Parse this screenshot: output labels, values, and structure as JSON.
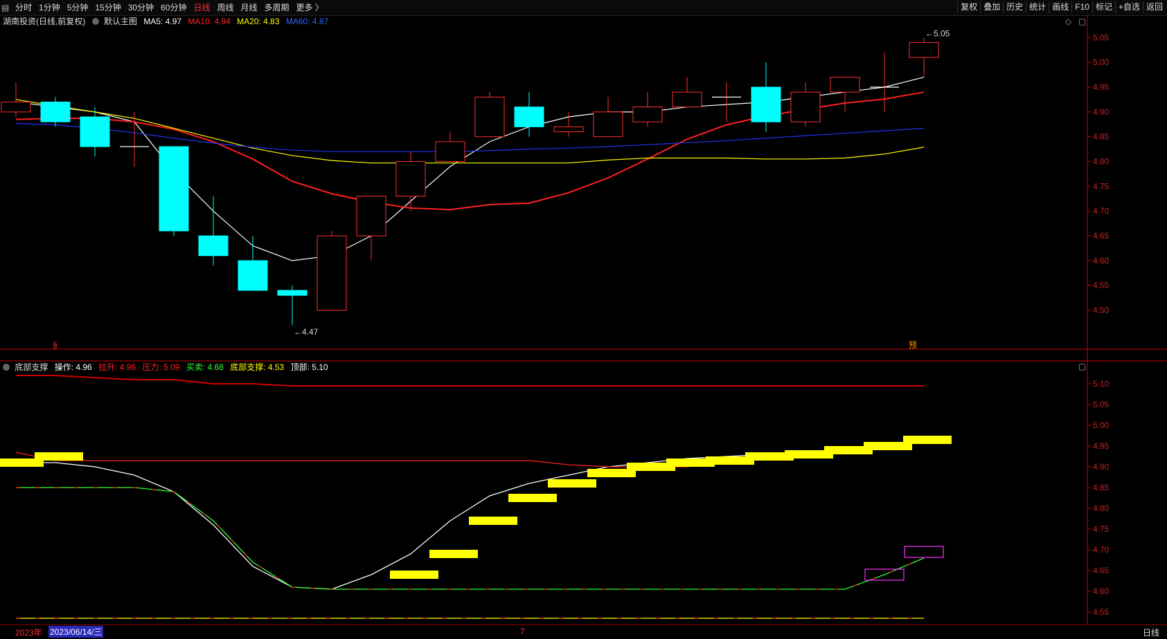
{
  "toolbar": {
    "left_items": [
      "分时",
      "1分钟",
      "5分钟",
      "15分钟",
      "30分钟",
      "60分钟",
      "日线",
      "周线",
      "月线",
      "多周期",
      "更多 〉"
    ],
    "active": "日线",
    "right_items": [
      "复权",
      "叠加",
      "历史",
      "统计",
      "画线",
      "F10",
      "标记",
      "+自选",
      "返回"
    ]
  },
  "main_legend": {
    "stock": "湖南投资(日线,前复权)",
    "template": "默认主图",
    "ma": [
      {
        "label": "MA5: 4.97",
        "color": "#ffffff"
      },
      {
        "label": "MA10: 4.94",
        "color": "#ff2020"
      },
      {
        "label": "MA20: 4.83",
        "color": "#ffff00"
      },
      {
        "label": "MA60: 4.87",
        "color": "#3366ff"
      }
    ]
  },
  "indicator_legend": {
    "name": "底部支撑",
    "items": [
      {
        "label": "操作: 4.96",
        "color": "#ffffff"
      },
      {
        "label": "拉升: 4.96",
        "color": "#ff2020"
      },
      {
        "label": "压力: 5.09",
        "color": "#ff2020"
      },
      {
        "label": "买卖: 4.68",
        "color": "#33ff33"
      },
      {
        "label": "底部支撑: 4.53",
        "color": "#ffff00"
      },
      {
        "label": "顶部: 5.10",
        "color": "#ffffff"
      }
    ]
  },
  "date_bar": {
    "year": "2023年",
    "cursor_date": "2023/06/14/三",
    "month_mark": "7",
    "period": "日线"
  },
  "markers": {
    "start": "§",
    "forecast": "预"
  },
  "colors": {
    "up": "#ff3030",
    "down": "#00ffff",
    "ma5": "#ffffff",
    "ma10": "#ff2020",
    "ma20": "#ffff00",
    "ma60": "#2233ee",
    "axis": "#cc0000",
    "buy": "#ffff00",
    "box": "#ff33ff"
  },
  "chart_data": [
    {
      "type": "candlestick",
      "y_ticks": [
        5.05,
        5.0,
        4.95,
        4.9,
        4.85,
        4.8,
        4.75,
        4.7,
        4.65,
        4.6,
        4.55,
        4.5
      ],
      "ylim": [
        4.445,
        5.07
      ],
      "candles": [
        {
          "o": 4.9,
          "h": 4.96,
          "l": 4.89,
          "c": 4.92
        },
        {
          "o": 4.92,
          "h": 4.93,
          "l": 4.87,
          "c": 4.88
        },
        {
          "o": 4.89,
          "h": 4.91,
          "l": 4.81,
          "c": 4.83
        },
        {
          "o": 4.83,
          "h": 4.9,
          "l": 4.79,
          "c": 4.83
        },
        {
          "o": 4.83,
          "h": 4.83,
          "l": 4.65,
          "c": 4.66
        },
        {
          "o": 4.65,
          "h": 4.73,
          "l": 4.59,
          "c": 4.61
        },
        {
          "o": 4.6,
          "h": 4.65,
          "l": 4.54,
          "c": 4.54
        },
        {
          "o": 4.54,
          "h": 4.55,
          "l": 4.47,
          "c": 4.53
        },
        {
          "o": 4.5,
          "h": 4.66,
          "l": 4.5,
          "c": 4.65
        },
        {
          "o": 4.65,
          "h": 4.73,
          "l": 4.6,
          "c": 4.73
        },
        {
          "o": 4.73,
          "h": 4.82,
          "l": 4.7,
          "c": 4.8
        },
        {
          "o": 4.8,
          "h": 4.86,
          "l": 4.8,
          "c": 4.84
        },
        {
          "o": 4.85,
          "h": 4.94,
          "l": 4.85,
          "c": 4.93
        },
        {
          "o": 4.91,
          "h": 4.94,
          "l": 4.85,
          "c": 4.87
        },
        {
          "o": 4.86,
          "h": 4.9,
          "l": 4.85,
          "c": 4.87
        },
        {
          "o": 4.85,
          "h": 4.93,
          "l": 4.85,
          "c": 4.9
        },
        {
          "o": 4.88,
          "h": 4.94,
          "l": 4.87,
          "c": 4.91
        },
        {
          "o": 4.91,
          "h": 4.97,
          "l": 4.91,
          "c": 4.94
        },
        {
          "o": 4.93,
          "h": 4.96,
          "l": 4.88,
          "c": 4.93
        },
        {
          "o": 4.95,
          "h": 5.0,
          "l": 4.86,
          "c": 4.88
        },
        {
          "o": 4.88,
          "h": 4.96,
          "l": 4.87,
          "c": 4.94
        },
        {
          "o": 4.94,
          "h": 4.97,
          "l": 4.9,
          "c": 4.97
        },
        {
          "o": 4.95,
          "h": 5.02,
          "l": 4.9,
          "c": 4.95
        },
        {
          "o": 5.01,
          "h": 5.05,
          "l": 4.97,
          "c": 5.04
        }
      ],
      "series": [
        {
          "name": "MA5",
          "values": [
            4.92,
            4.91,
            4.9,
            4.88,
            4.78,
            4.7,
            4.63,
            4.6,
            4.61,
            4.65,
            4.72,
            4.79,
            4.84,
            4.87,
            4.89,
            4.9,
            4.9,
            4.91,
            4.915,
            4.92,
            4.93,
            4.94,
            4.95,
            4.97
          ]
        },
        {
          "name": "MA10",
          "values": [
            4.885,
            4.887,
            4.887,
            4.88,
            4.865,
            4.84,
            4.805,
            4.76,
            4.735,
            4.718,
            4.706,
            4.703,
            4.713,
            4.716,
            4.737,
            4.767,
            4.805,
            4.845,
            4.874,
            4.892,
            4.905,
            4.918,
            4.926,
            4.94
          ]
        },
        {
          "name": "MA20",
          "values": [
            4.925,
            4.912,
            4.9,
            4.887,
            4.867,
            4.847,
            4.827,
            4.812,
            4.802,
            4.797,
            4.797,
            4.797,
            4.797,
            4.797,
            4.797,
            4.803,
            4.807,
            4.807,
            4.807,
            4.805,
            4.805,
            4.807,
            4.815,
            4.829
          ]
        },
        {
          "name": "MA60",
          "values": [
            4.877,
            4.874,
            4.867,
            4.858,
            4.847,
            4.837,
            4.829,
            4.823,
            4.82,
            4.82,
            4.82,
            4.82,
            4.822,
            4.825,
            4.827,
            4.83,
            4.834,
            4.838,
            4.842,
            4.847,
            4.852,
            4.857,
            4.862,
            4.867
          ]
        }
      ],
      "annotations": [
        {
          "text": "4.47",
          "index": 7,
          "value": 4.47
        },
        {
          "text": "5.05",
          "index": 23,
          "value": 5.05
        }
      ]
    },
    {
      "type": "line",
      "name": "底部支撑",
      "y_ticks": [
        5.1,
        5.05,
        5.0,
        4.95,
        4.9,
        4.85,
        4.8,
        4.75,
        4.7,
        4.65,
        4.6,
        4.55
      ],
      "ylim": [
        4.525,
        5.125
      ],
      "series": [
        {
          "name": "操作",
          "values": [
            4.91,
            4.91,
            4.9,
            4.88,
            4.84,
            4.76,
            4.66,
            4.61,
            4.605,
            4.64,
            4.69,
            4.77,
            4.83,
            4.86,
            4.88,
            4.9,
            4.91,
            4.92,
            4.925,
            4.93,
            4.935,
            4.94,
            4.95,
            4.96
          ]
        },
        {
          "name": "拉升",
          "values": [
            4.935,
            4.915,
            4.915,
            4.915,
            4.915,
            4.915,
            4.915,
            4.915,
            4.915,
            4.915,
            4.915,
            4.915,
            4.915,
            4.915,
            4.905,
            4.9,
            4.9,
            4.9,
            4.91,
            4.92,
            4.93,
            4.94,
            4.95,
            4.96
          ]
        },
        {
          "name": "压力",
          "values": [
            5.12,
            5.12,
            5.115,
            5.11,
            5.11,
            5.1,
            5.1,
            5.095,
            5.095,
            5.095,
            5.095,
            5.095,
            5.095,
            5.095,
            5.095,
            5.095,
            5.095,
            5.095,
            5.095,
            5.095,
            5.095,
            5.095,
            5.095,
            5.095
          ]
        },
        {
          "name": "买卖",
          "values": [
            4.85,
            4.85,
            4.85,
            4.85,
            4.84,
            4.77,
            4.67,
            4.61,
            4.605,
            4.605,
            4.605,
            4.605,
            4.605,
            4.605,
            4.605,
            4.605,
            4.605,
            4.605,
            4.605,
            4.605,
            4.605,
            4.605,
            4.64,
            4.68
          ]
        },
        {
          "name": "底部支撑",
          "values": [
            4.535,
            4.535,
            4.535,
            4.535,
            4.535,
            4.535,
            4.535,
            4.535,
            4.535,
            4.535,
            4.535,
            4.535,
            4.535,
            4.535,
            4.535,
            4.535,
            4.535,
            4.535,
            4.535,
            4.535,
            4.535,
            4.535,
            4.535,
            4.535
          ]
        }
      ],
      "yellow_bars": [
        {
          "index": 0,
          "value": 4.91
        },
        {
          "index": 1,
          "value": 4.925
        },
        {
          "index": 10,
          "value": 4.64
        },
        {
          "index": 11,
          "value": 4.69
        },
        {
          "index": 12,
          "value": 4.77
        },
        {
          "index": 13,
          "value": 4.825
        },
        {
          "index": 14,
          "value": 4.86
        },
        {
          "index": 15,
          "value": 4.885
        },
        {
          "index": 16,
          "value": 4.9
        },
        {
          "index": 17,
          "value": 4.91
        },
        {
          "index": 18,
          "value": 4.915
        },
        {
          "index": 19,
          "value": 4.925
        },
        {
          "index": 20,
          "value": 4.93
        },
        {
          "index": 21,
          "value": 4.94
        },
        {
          "index": 22,
          "value": 4.95
        },
        {
          "index": 23,
          "value": 4.965
        }
      ],
      "boxes": [
        {
          "index": 22,
          "value": 4.64
        },
        {
          "index": 23,
          "value": 4.695
        }
      ]
    }
  ]
}
